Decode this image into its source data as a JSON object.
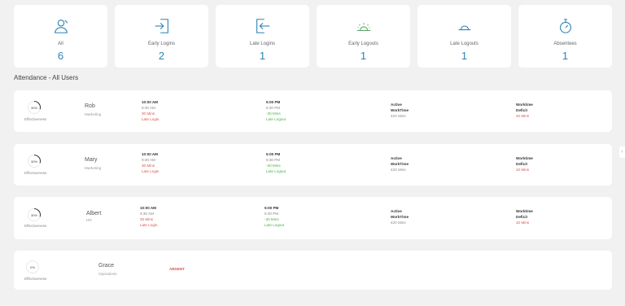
{
  "stats": [
    {
      "label": "All",
      "value": "6",
      "icon": "user-icon"
    },
    {
      "label": "Early Logins",
      "value": "2",
      "icon": "login-icon"
    },
    {
      "label": "Late Logins",
      "value": "1",
      "icon": "logout-door-icon"
    },
    {
      "label": "Early Logouts",
      "value": "1",
      "icon": "sunrise-icon"
    },
    {
      "label": "Late Logouts",
      "value": "1",
      "icon": "sunset-icon"
    },
    {
      "label": "Absentees",
      "value": "1",
      "icon": "stopwatch-icon"
    }
  ],
  "section_title": "Attendance - All Users",
  "effectiveness_label": "Effectiveness",
  "active_label_1": "Active",
  "active_label_2": "WorkTime",
  "deficit_label_1": "Worktime",
  "deficit_label_2": "Deficit",
  "users": [
    {
      "percent": "30%",
      "percent_num": 30,
      "name": "Rob",
      "dept": "Marketing",
      "login_time": "10:00 AM",
      "login_sched": "9:30 AM",
      "login_diff": "30 Mins",
      "login_status": "Late Login",
      "logout_time": "5:00 PM",
      "logout_sched": "5:30 PM",
      "logout_diff": "-30 Mins",
      "logout_status": "Late Logout",
      "active_time": "420 Mins",
      "deficit": "20 Mins"
    },
    {
      "percent": "30%",
      "percent_num": 30,
      "name": "Mary",
      "dept": "Marketing",
      "login_time": "10:00 AM",
      "login_sched": "9:30 AM",
      "login_diff": "30 Mins",
      "login_status": "Late Login",
      "logout_time": "5:00 PM",
      "logout_sched": "5:30 PM",
      "logout_diff": "-30 Mins",
      "logout_status": "Late Logout",
      "active_time": "420 Mins",
      "deficit": "10 Mins"
    },
    {
      "percent": "30%",
      "percent_num": 30,
      "name": "Albert",
      "dept": "HR",
      "login_time": "10:00 AM",
      "login_sched": "9:30 AM",
      "login_diff": "30 Mins",
      "login_status": "Late Login",
      "logout_time": "5:00 PM",
      "logout_sched": "5:30 PM",
      "logout_diff": "-30 Mins",
      "logout_status": "Late Logout",
      "active_time": "420 Mins",
      "deficit": "10 Mins"
    }
  ],
  "absent_user": {
    "percent": "0%",
    "percent_num": 0,
    "name": "Grace",
    "dept": "Operations",
    "status": "ABSENT"
  },
  "colors": {
    "accent": "#2d82b5",
    "late": "#d9534f",
    "ok": "#4caf50"
  }
}
